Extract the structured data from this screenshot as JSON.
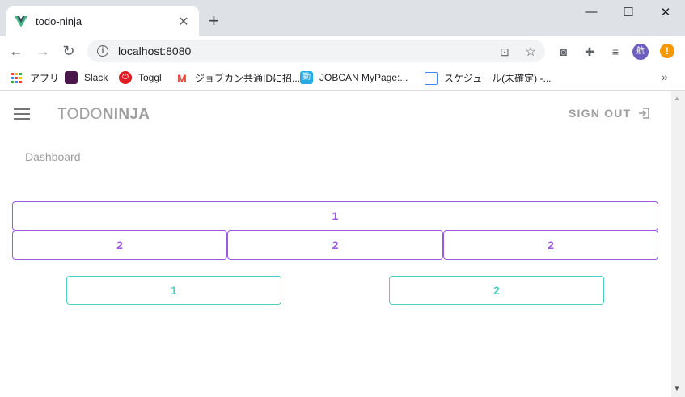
{
  "browser": {
    "tab_title": "todo-ninja",
    "tab_close": "✕",
    "new_tab": "+",
    "url": "localhost:8080",
    "profile_initial": "航",
    "update_badge": "!",
    "controls": {
      "minimize": "—",
      "maximize": "☐",
      "close": "✕"
    }
  },
  "bookmarks": [
    {
      "label": "アプリ",
      "icon": "apps-grid-icon"
    },
    {
      "label": "Slack",
      "icon": "slack-icon"
    },
    {
      "label": "Toggl",
      "icon": "toggl-icon"
    },
    {
      "label": "ジョブカン共通IDに招...",
      "icon": "gmail-icon"
    },
    {
      "label": "JOBCAN MyPage:...",
      "icon": "jobcan-icon"
    },
    {
      "label": "スケジュール(未確定) -...",
      "icon": "calendar-icon"
    }
  ],
  "app": {
    "brand_light": "TODO",
    "brand_bold": "NINJA",
    "signout": "SIGN OUT",
    "breadcrumb": "Dashboard"
  },
  "buttons": {
    "row1": [
      "1"
    ],
    "row2": [
      "2",
      "2",
      "2"
    ],
    "row3": [
      "1",
      "2"
    ]
  },
  "colors": {
    "purple": "#9b59e0",
    "teal": "#4dd0c0",
    "grey_text": "#9e9e9e"
  }
}
